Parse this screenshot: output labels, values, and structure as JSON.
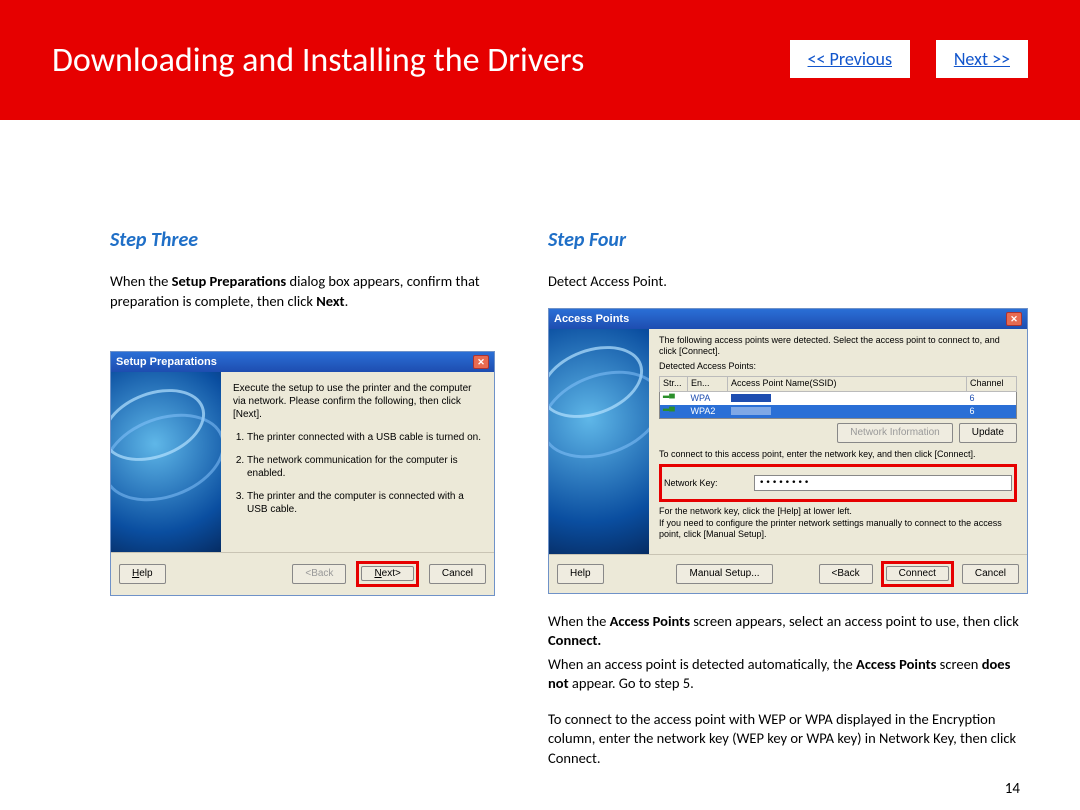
{
  "header": {
    "title": "Downloading and Installing  the Drivers",
    "prev": "<< Previous",
    "next": "Next >>"
  },
  "page_number": "14",
  "left": {
    "step_title": "Step Three",
    "para1_a": "When the ",
    "para1_b": "Setup Preparations",
    "para1_c": " dialog box appears, confirm that preparation is complete, then click ",
    "para1_d": "Next",
    "para1_e": "."
  },
  "right": {
    "step_title": "Step Four",
    "detect": "Detect Access Point.",
    "p2_a": "When the ",
    "p2_b": "Access Points",
    "p2_c": " screen appears, select an access point to use, then click ",
    "p2_d": "Connect.",
    "p3_a": "When an access point is detected automatically, the ",
    "p3_b": "Access Points",
    "p3_c": " screen ",
    "p3_d": "does not",
    "p3_e": " appear. Go to step 5.",
    "p4": "To connect to the access point with WEP or WPA displayed in the Encryption column, enter the network key (WEP key or WPA key) in Network Key, then click Connect."
  },
  "dlg1": {
    "title": "Setup Preparations",
    "intro": "Execute the setup to use the printer and the computer via network. Please confirm the following, then click [Next].",
    "li1": "The printer connected with a USB cable is turned on.",
    "li2": "The network communication for the computer is enabled.",
    "li3": "The printer and the computer is connected with a USB cable.",
    "help": "Help",
    "back": "<Back",
    "next": "Next>",
    "cancel": "Cancel"
  },
  "dlg2": {
    "title": "Access Points",
    "intro": "The following access points were detected. Select the access point to connect to, and click [Connect].",
    "detected_label": "Detected Access Points:",
    "col_str": "Str...",
    "col_en": "En...",
    "col_ssid": "Access Point Name(SSID)",
    "col_ch": "Channel",
    "row1_en": "WPA",
    "row1_ch": "6",
    "row2_en": "WPA2",
    "row2_ch": "6",
    "netinfo": "Network Information",
    "update": "Update",
    "connect_hint": "To connect to this access point, enter the network key, and then click [Connect].",
    "nk_label": "Network Key:",
    "nk_value": "••••••••",
    "fine_print": "For the network key, click the [Help] at lower left.\nIf you need to configure the printer network settings manually to connect to the access point, click [Manual Setup].",
    "help": "Help",
    "manual": "Manual Setup...",
    "back": "<Back",
    "connect": "Connect",
    "cancel": "Cancel"
  }
}
